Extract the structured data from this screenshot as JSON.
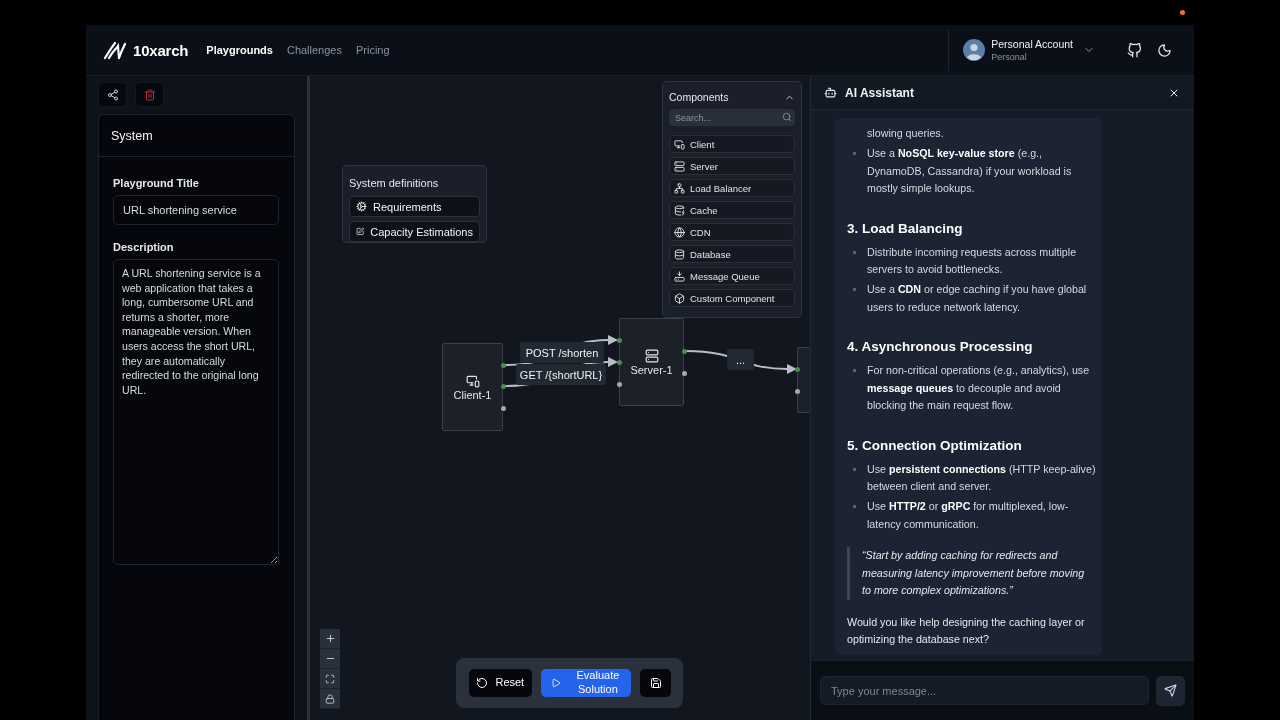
{
  "header": {
    "logo": "10xarch",
    "nav": [
      {
        "label": "Playgrounds",
        "selected": true
      },
      {
        "label": "Challenges",
        "selected": false
      },
      {
        "label": "Pricing",
        "selected": false
      }
    ],
    "account": {
      "name": "Personal Account",
      "plan": "Personal"
    }
  },
  "sidebar": {
    "title": "System",
    "fields": [
      {
        "kind": "input",
        "label": "Playground Title",
        "value": "URL shortening service"
      },
      {
        "kind": "textarea",
        "label": "Description",
        "value": "A URL shortening service is a web application that takes a long, cumbersome URL and returns a shorter, more manageable version. When users access the short URL, they are automatically redirected to the original long URL."
      }
    ]
  },
  "canvas": {
    "system_definitions": {
      "title": "System definitions",
      "items": [
        {
          "kind": "requirements",
          "label": "Requirements"
        },
        {
          "kind": "estimations",
          "label": "Capacity Estimations"
        }
      ]
    },
    "components": {
      "title": "Components",
      "expanded": true,
      "search_placeholder": "Search...",
      "items": [
        {
          "kind": "client",
          "label": "Client"
        },
        {
          "kind": "server",
          "label": "Server"
        },
        {
          "kind": "load_balancer",
          "label": "Load Balancer"
        },
        {
          "kind": "cache",
          "label": "Cache"
        },
        {
          "kind": "cdn",
          "label": "CDN"
        },
        {
          "kind": "database",
          "label": "Database"
        },
        {
          "kind": "message_queue",
          "label": "Message Queue"
        },
        {
          "kind": "custom",
          "label": "Custom Component"
        }
      ]
    },
    "nodes": [
      {
        "kind": "client",
        "label": "Client-1",
        "handles": [
          {
            "kind": "source",
            "connected": true
          },
          {
            "kind": "source",
            "connected": true
          },
          {
            "kind": "source",
            "connected": false
          }
        ]
      },
      {
        "kind": "server",
        "label": "Server-1",
        "handles": [
          {
            "kind": "target",
            "connected": true
          },
          {
            "kind": "target",
            "connected": true
          },
          {
            "kind": "target",
            "connected": false
          },
          {
            "kind": "source",
            "connected": true
          },
          {
            "kind": "source",
            "connected": false
          }
        ]
      },
      {
        "kind": "blank",
        "handles": [
          {
            "kind": "target",
            "connected": true
          },
          {
            "kind": "target",
            "connected": false
          }
        ]
      }
    ],
    "edges": [
      {
        "label": "POST /shorten"
      },
      {
        "label": "GET /{shortURL}"
      },
      {
        "label": "..."
      }
    ],
    "toolbar": [
      {
        "kind": "reset",
        "label": "Reset"
      },
      {
        "kind": "evaluate",
        "label": "Evaluate Solution"
      }
    ]
  },
  "assistant": {
    "title": "AI Assistant",
    "message": [
      {
        "kind": "continuation",
        "text": "slowing queries."
      },
      {
        "kind": "bullet",
        "text": "Use a **NoSQL key-value store** (e.g., DynamoDB, Cassandra) if your workload is mostly simple lookups."
      },
      {
        "kind": "heading",
        "text": "3. Load Balancing"
      },
      {
        "kind": "bullet",
        "text": "Distribute incoming requests across multiple servers to avoid bottlenecks."
      },
      {
        "kind": "bullet",
        "text": "Use a **CDN** or edge caching if you have global users to reduce network latency."
      },
      {
        "kind": "heading",
        "text": "4. Asynchronous Processing"
      },
      {
        "kind": "bullet",
        "text": "For non-critical operations (e.g., analytics), use **message queues** to decouple and avoid blocking the main request flow."
      },
      {
        "kind": "heading",
        "text": "5. Connection Optimization"
      },
      {
        "kind": "bullet",
        "text": "Use **persistent connections** (HTTP keep-alive) between client and server."
      },
      {
        "kind": "bullet",
        "text": "Use **HTTP/2** or **gRPC** for multiplexed, low-latency communication."
      },
      {
        "kind": "quote",
        "text": "“Start by adding caching for redirects and measuring latency improvement before moving to more complex optimizations.”"
      },
      {
        "kind": "paragraph",
        "text": "Would you like help designing the caching layer or optimizing the database next?"
      }
    ],
    "input": {
      "placeholder": "Type your message..."
    }
  }
}
